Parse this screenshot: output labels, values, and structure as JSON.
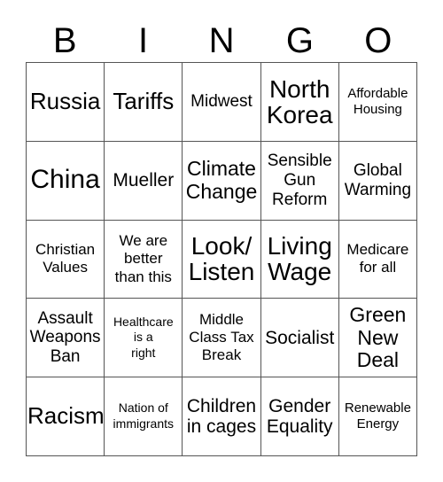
{
  "card": {
    "title": "BINGO",
    "header_letters": [
      "B",
      "I",
      "N",
      "G",
      "O"
    ],
    "columns": 5,
    "rows": 5,
    "colors": {
      "background": "#ffffff",
      "text": "#000000",
      "grid_line": "#555555"
    },
    "squares": [
      [
        {
          "text": "Russia",
          "size": "fs-xxl"
        },
        {
          "text": "Tariffs",
          "size": "fs-xxl"
        },
        {
          "text": "Midwest",
          "size": "fs-ml"
        },
        {
          "text": "North\nKorea",
          "size": "fs-3xl"
        },
        {
          "text": "Affordable\nHousing",
          "size": "fs-s"
        }
      ],
      [
        {
          "text": "China",
          "size": "fs-4xl"
        },
        {
          "text": "Mueller",
          "size": "fs-l"
        },
        {
          "text": "Climate\nChange",
          "size": "fs-xl"
        },
        {
          "text": "Sensible\nGun\nReform",
          "size": "fs-ml"
        },
        {
          "text": "Global\nWarming",
          "size": "fs-ml"
        }
      ],
      [
        {
          "text": "Christian\nValues",
          "size": "fs-m"
        },
        {
          "text": "We are\nbetter\nthan this",
          "size": "fs-m"
        },
        {
          "text": "Look/\nListen",
          "size": "fs-3xl"
        },
        {
          "text": "Living\nWage",
          "size": "fs-3xl"
        },
        {
          "text": "Medicare\nfor all",
          "size": "fs-m"
        }
      ],
      [
        {
          "text": "Assault\nWeapons\nBan",
          "size": "fs-ml"
        },
        {
          "text": "Healthcare\nis a\nright",
          "size": "fs-xs"
        },
        {
          "text": "Middle\nClass Tax\nBreak",
          "size": "fs-m"
        },
        {
          "text": "Socialist",
          "size": "fs-l"
        },
        {
          "text": "Green\nNew\nDeal",
          "size": "fs-xl"
        }
      ],
      [
        {
          "text": "Racism",
          "size": "fs-xxl"
        },
        {
          "text": "Nation of\nimmigrants",
          "size": "fs-xs"
        },
        {
          "text": "Children\nin cages",
          "size": "fs-l"
        },
        {
          "text": "Gender\nEquality",
          "size": "fs-l"
        },
        {
          "text": "Renewable\nEnergy",
          "size": "fs-s"
        }
      ]
    ]
  }
}
